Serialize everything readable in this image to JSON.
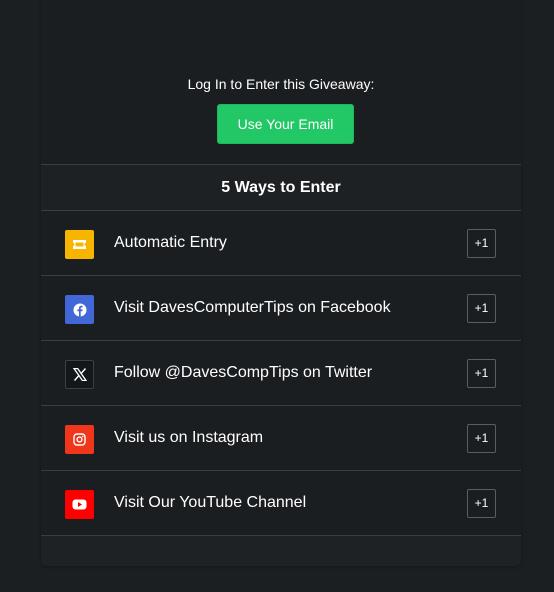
{
  "login": {
    "prompt": "Log In to Enter this Giveaway:",
    "email_button": "Use Your Email"
  },
  "ways": {
    "header": "5 Ways to Enter"
  },
  "entries": [
    {
      "label": "Automatic Entry",
      "points": "+1",
      "icon": "ticket-icon",
      "color": "#f7b500"
    },
    {
      "label": "Visit DavesComputerTips on Facebook",
      "points": "+1",
      "icon": "facebook-icon",
      "color": "#4267d6"
    },
    {
      "label": "Follow @DavesCompTips on Twitter",
      "points": "+1",
      "icon": "x-twitter-icon",
      "color": "#14171a"
    },
    {
      "label": "Visit us on Instagram",
      "points": "+1",
      "icon": "instagram-icon",
      "color": "#f0361b"
    },
    {
      "label": "Visit Our YouTube Channel",
      "points": "+1",
      "icon": "youtube-icon",
      "color": "#ff0000"
    }
  ],
  "colors": {
    "background": "#1c1f22",
    "accent_button": "#22c865",
    "divider": "#3a3d41"
  }
}
